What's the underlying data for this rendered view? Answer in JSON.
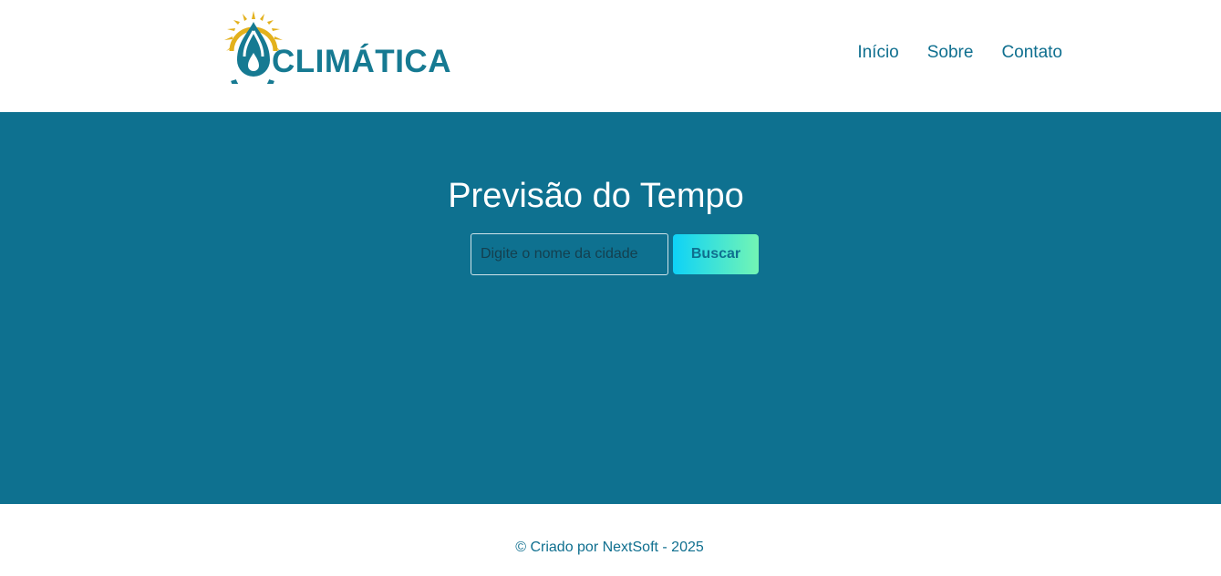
{
  "header": {
    "logo_text": "CLIMÁTICA",
    "nav": [
      {
        "label": "Início"
      },
      {
        "label": "Sobre"
      },
      {
        "label": "Contato"
      }
    ]
  },
  "main": {
    "title": "Previsão do Tempo",
    "search": {
      "placeholder": "Digite o nome da cidade",
      "value": "",
      "button_label": "Buscar"
    }
  },
  "footer": {
    "text": "© Criado por NextSoft - 2025"
  },
  "colors": {
    "brand_teal": "#0e7190",
    "logo_teal": "#167a92",
    "sun_gold": "#e3b11c",
    "button_gradient_start": "#0ed2f7",
    "button_gradient_end": "#73f5b4"
  },
  "icons": [
    "sun-icon",
    "water-drop-icon"
  ]
}
